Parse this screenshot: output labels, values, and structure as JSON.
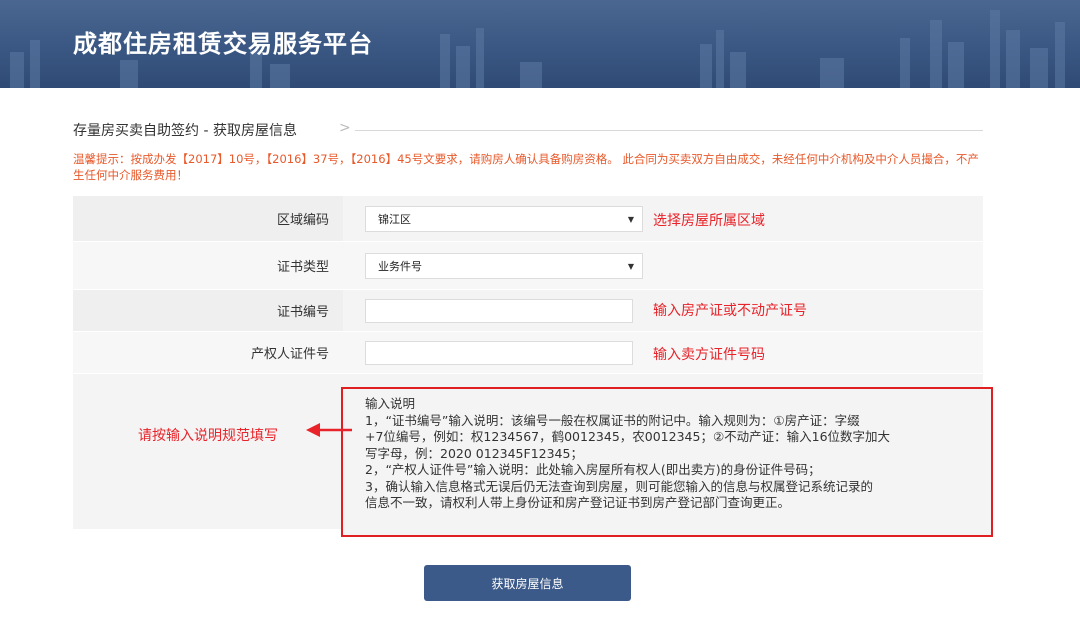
{
  "header": {
    "site_title": "成都住房租赁交易服务平台"
  },
  "section": {
    "title": "存量房买卖自助签约 - 获取房屋信息",
    "chevron": ">"
  },
  "notice": {
    "text": "温馨提示：按成办发【2017】10号，【2016】37号，【2016】45号文要求，请购房人确认具备购房资格。 此合同为买卖双方自由成交，未经任何中介机构及中介人员撮合，不产生任何中介服务费用！"
  },
  "form": {
    "region": {
      "label": "区域编码",
      "selected": "锦江区",
      "hint": "选择房屋所属区域"
    },
    "cert_type": {
      "label": "证书类型",
      "selected": "业务件号"
    },
    "cert_no": {
      "label": "证书编号",
      "value": "",
      "hint": "输入房产证或不动产证号"
    },
    "owner_id": {
      "label": "产权人证件号",
      "value": "",
      "hint": "输入卖方证件号码"
    },
    "explain": {
      "left_note": "请按输入说明规范填写",
      "lines": [
        "输入说明",
        "1，“证书编号”输入说明：该编号一般在权属证书的附记中。输入规则为：①房产证：字缀",
        "+7位编号，例如：权1234567，鹤0012345，农0012345；②不动产证：输入16位数字加大",
        "写字母，例：2020 012345F12345；",
        "2，“产权人证件号”输入说明：此处输入房屋所有权人(即出卖方)的身份证件号码；",
        "3，确认输入信息格式无误后仍无法查询到房屋，则可能您输入的信息与权属登记系统记录的",
        "信息不一致，请权利人带上身份证和房产登记证书到房产登记部门查询更正。"
      ]
    }
  },
  "submit": {
    "label": "获取房屋信息"
  },
  "colors": {
    "header_bg": "#3a5783",
    "accent_red": "#e8232a",
    "notice_orange": "#e8592b",
    "button_bg": "#3c5a89"
  },
  "icons": {
    "dropdown": "dropdown-arrow-icon",
    "pointer": "arrow-left-icon"
  }
}
